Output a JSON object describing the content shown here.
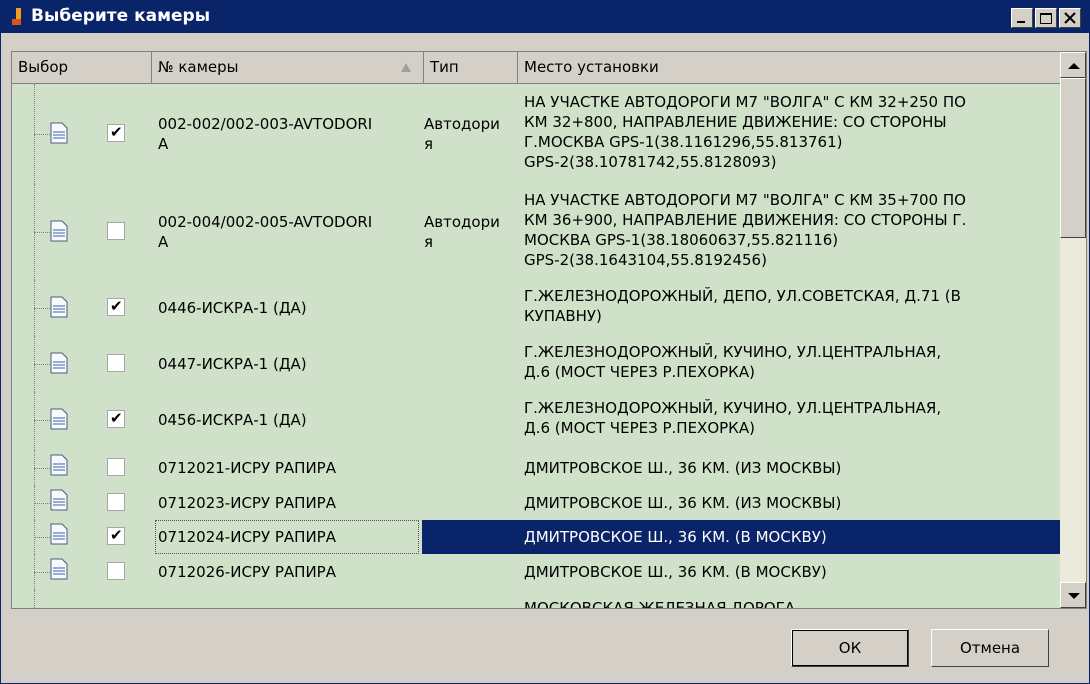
{
  "window": {
    "title": "Выберите камеры"
  },
  "grid": {
    "columns": [
      "Выбор",
      "№ камеры",
      "Тип",
      "Место установки"
    ],
    "rows": [
      {
        "checked": true,
        "num": "002-002/002-003-AVTODORI\nA",
        "type": "Автодори\nя",
        "place": "НА УЧАСТКЕ АВТОДОРОГИ М7 \"ВОЛГА\" С КМ 32+250 ПО\nКМ 32+800, НАПРАВЛЕНИЕ ДВИЖЕНИЕ: СО СТОРОНЫ\nГ.МОСКВА GPS-1(38.1161296,55.813761)\nGPS-2(38.10781742,55.8128093)",
        "selected": false
      },
      {
        "checked": false,
        "num": "002-004/002-005-AVTODORI\nA",
        "type": "Автодори\nя",
        "place": "НА УЧАСТКЕ АВТОДОРОГИ М7 \"ВОЛГА\" С КМ 35+700 ПО\nКМ 36+900, НАПРАВЛЕНИЕ ДВИЖЕНИЯ: СО СТОРОНЫ Г.\nМОСКВА GPS-1(38.18060637,55.821116)\nGPS-2(38.1643104,55.8192456)",
        "selected": false
      },
      {
        "checked": true,
        "num": "0446-ИСКРА-1 (ДА)",
        "type": "",
        "place": "Г.ЖЕЛЕЗНОДОРОЖНЫЙ, ДЕПО, УЛ.СОВЕТСКАЯ, Д.71 (В\nКУПАВНУ)",
        "selected": false
      },
      {
        "checked": false,
        "num": "0447-ИСКРА-1 (ДА)",
        "type": "",
        "place": "Г.ЖЕЛЕЗНОДОРОЖНЫЙ, КУЧИНО, УЛ.ЦЕНТРАЛЬНАЯ,\nД.6 (МОСТ ЧЕРЕЗ Р.ПЕХОРКА)",
        "selected": false
      },
      {
        "checked": true,
        "num": "0456-ИСКРА-1 (ДА)",
        "type": "",
        "place": "Г.ЖЕЛЕЗНОДОРОЖНЫЙ, КУЧИНО, УЛ.ЦЕНТРАЛЬНАЯ,\nД.6 (МОСТ ЧЕРЕЗ Р.ПЕХОРКА)",
        "selected": false
      },
      {
        "checked": false,
        "num": "0712021-ИСРУ РАПИРА",
        "type": "",
        "place": "ДМИТРОВСКОЕ Ш., 36 КМ. (ИЗ МОСКВЫ)",
        "selected": false
      },
      {
        "checked": false,
        "num": "0712023-ИСРУ РАПИРА",
        "type": "",
        "place": "ДМИТРОВСКОЕ Ш., 36 КМ. (ИЗ МОСКВЫ)",
        "selected": false
      },
      {
        "checked": true,
        "num": "0712024-ИСРУ РАПИРА",
        "type": "",
        "place": "ДМИТРОВСКОЕ Ш., 36 КМ. (В МОСКВУ)",
        "selected": true
      },
      {
        "checked": false,
        "num": "0712026-ИСРУ РАПИРА",
        "type": "",
        "place": "ДМИТРОВСКОЕ Ш., 36 КМ. (В МОСКВУ)",
        "selected": false
      },
      {
        "checked": false,
        "num": "",
        "type": "",
        "place": "МОСКОВСКАЯ ЖЕЛЕЗНАЯ ДОРОГА,",
        "selected": false,
        "partial": true
      }
    ]
  },
  "buttons": {
    "ok": "ОК",
    "cancel": "Отмена"
  },
  "colors": {
    "titlebar": "#0a246a",
    "row_bg": "#cfe1c8",
    "selection": "#0a246a"
  }
}
